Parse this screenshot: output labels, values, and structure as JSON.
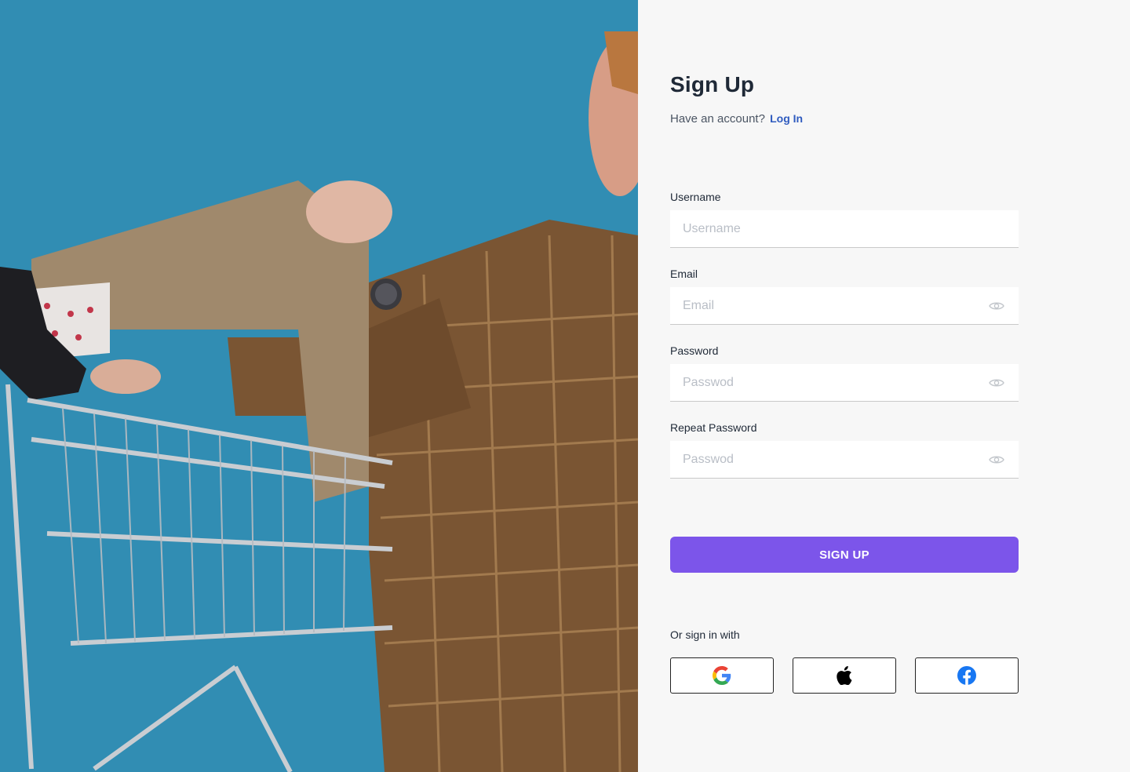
{
  "form": {
    "title": "Sign Up",
    "have_account_text": "Have an account?",
    "login_link": "Log In",
    "fields": [
      {
        "label": "Username",
        "placeholder": "Username",
        "value": ""
      },
      {
        "label": "Email",
        "placeholder": "Email",
        "value": ""
      },
      {
        "label": "Password",
        "placeholder": "Passwod",
        "value": ""
      },
      {
        "label": "Repeat Password",
        "placeholder": "Passwod",
        "value": ""
      }
    ],
    "submit_label": "SIGN UP",
    "social_prompt": "Or sign in with",
    "social_providers": [
      "google-icon",
      "apple-icon",
      "facebook-icon"
    ]
  },
  "colors": {
    "accent": "#7c55ea",
    "link": "#2f5bbf",
    "hero_background": "#2f8ab0",
    "panel_background": "#f7f7f7",
    "facebook": "#1877f2"
  }
}
